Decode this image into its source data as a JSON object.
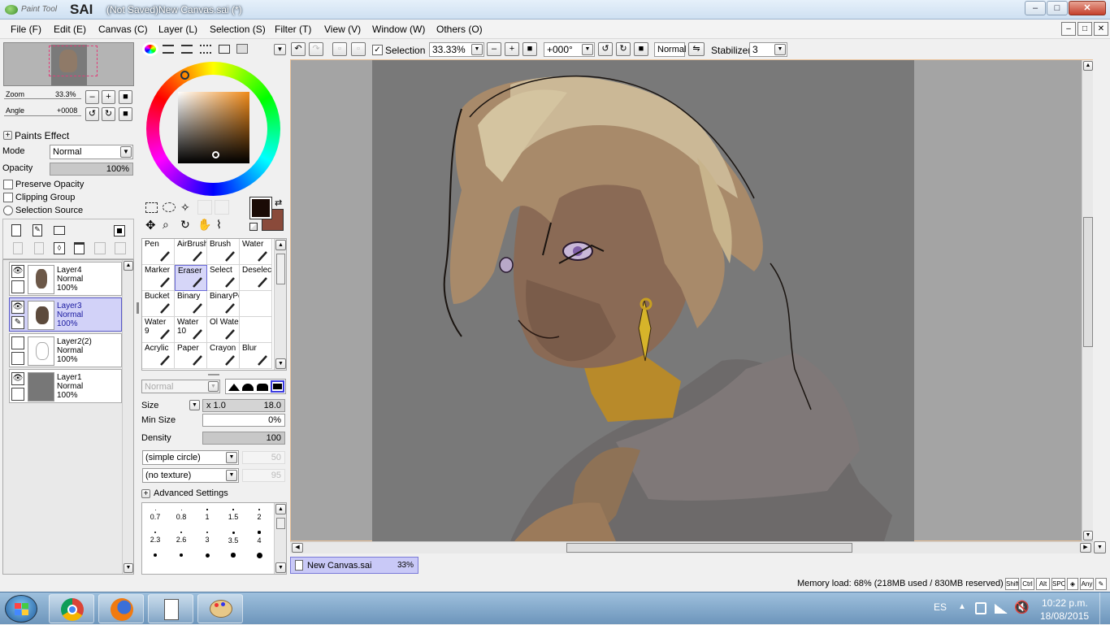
{
  "window": {
    "app_name_small": "Paint Tool",
    "app_name": "SAI",
    "title": "(Not Saved)New Canvas.sai (*)",
    "min_label": "–",
    "max_label": "□",
    "close_label": "✕"
  },
  "menu": [
    "File (F)",
    "Edit (E)",
    "Canvas (C)",
    "Layer (L)",
    "Selection (S)",
    "Filter (T)",
    "View (V)",
    "Window (W)",
    "Others (O)"
  ],
  "navigator": {
    "zoom_label": "Zoom",
    "zoom_value": "33.3%",
    "angle_label": "Angle",
    "angle_value": "+0008"
  },
  "paints_effect": {
    "header": "Paints Effect",
    "mode_label": "Mode",
    "mode_value": "Normal",
    "opacity_label": "Opacity",
    "opacity_value": "100%",
    "preserve_opacity": "Preserve Opacity",
    "clipping_group": "Clipping Group",
    "selection_source": "Selection Source"
  },
  "layers": [
    {
      "name": "Layer4",
      "mode": "Normal",
      "opacity": "100%",
      "visible": true,
      "selected": false
    },
    {
      "name": "Layer3",
      "mode": "Normal",
      "opacity": "100%",
      "visible": true,
      "selected": true
    },
    {
      "name": "Layer2(2)",
      "mode": "Normal",
      "opacity": "100%",
      "visible": false,
      "selected": false
    },
    {
      "name": "Layer1",
      "mode": "Normal",
      "opacity": "100%",
      "visible": true,
      "selected": false
    }
  ],
  "colors": {
    "primary": "#1a0b06",
    "secondary": "#8a4a3a",
    "accent_select": "#d2d2f8"
  },
  "tools": [
    {
      "name": "Pen",
      "selected": false
    },
    {
      "name": "AirBrush",
      "selected": false
    },
    {
      "name": "Brush",
      "selected": false
    },
    {
      "name": "Water",
      "selected": false
    },
    {
      "name": "Marker",
      "selected": false
    },
    {
      "name": "Eraser",
      "selected": true
    },
    {
      "name": "Select",
      "selected": false
    },
    {
      "name": "Deselect",
      "selected": false
    },
    {
      "name": "Bucket",
      "selected": false
    },
    {
      "name": "Binary",
      "selected": false
    },
    {
      "name": "BinaryPe",
      "selected": false
    },
    {
      "name": "",
      "selected": false
    },
    {
      "name": "Water\n9",
      "selected": false
    },
    {
      "name": "Water\n10",
      "selected": false
    },
    {
      "name": "Ol Water",
      "selected": false
    },
    {
      "name": "",
      "selected": false
    },
    {
      "name": "Acrylic",
      "selected": false
    },
    {
      "name": "Paper",
      "selected": false
    },
    {
      "name": "Crayon",
      "selected": false
    },
    {
      "name": "Blur",
      "selected": false
    }
  ],
  "brush": {
    "blend_mode": "Normal",
    "size_label": "Size",
    "size_mult": "x 1.0",
    "size_value": "18.0",
    "min_size_label": "Min Size",
    "min_size_value": "0%",
    "density_label": "Density",
    "density_value": "100",
    "shape": "(simple circle)",
    "shape_value": "50",
    "texture": "(no texture)",
    "texture_value": "95",
    "advanced": "Advanced Settings"
  },
  "brush_sizes": [
    "0.7",
    "0.8",
    "1",
    "1.5",
    "2",
    "2.3",
    "2.6",
    "3",
    "3.5",
    "4",
    "",
    "",
    "",
    "",
    ""
  ],
  "toolbar": {
    "selection_label": "Selection",
    "zoom_value": "33.33%",
    "angle_value": "+000°",
    "blend": "Normal",
    "stabilizer_label": "Stabilizer",
    "stabilizer_value": "3"
  },
  "document_tab": {
    "name": "New Canvas.sai",
    "zoom": "33%"
  },
  "status": {
    "memory": "Memory load: 68% (218MB used / 830MB reserved)",
    "keys": [
      "Shift",
      "Ctrl",
      "Alt",
      "SPC",
      "◈",
      "Any",
      "✎"
    ]
  },
  "taskbar": {
    "lang": "ES",
    "time": "10:22 p.m.",
    "date": "18/08/2015",
    "apps": [
      "chrome-icon",
      "firefox-icon",
      "notepad-icon",
      "paint-icon"
    ]
  }
}
